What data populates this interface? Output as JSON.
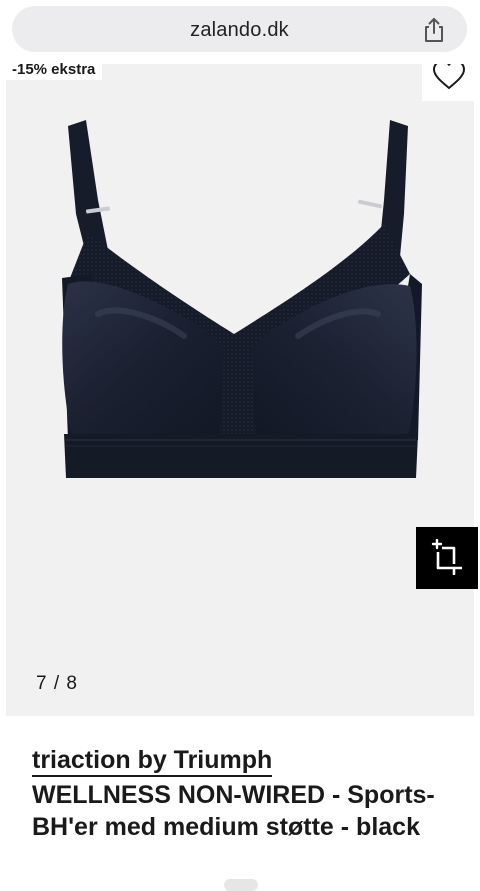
{
  "browser": {
    "url": "zalando.dk",
    "share_icon": "share-icon"
  },
  "gallery": {
    "badge": "-15% ekstra",
    "wishlist_icon": "heart-outline-icon",
    "crop_icon": "crop-sparkle-icon",
    "counter": "7 / 8",
    "background": "#f1f1f1"
  },
  "product": {
    "brand": "triaction by Triumph",
    "name": "WELLNESS NON-WIRED - Sports-BH'er med medium støtte - black",
    "color": "#1c2333"
  }
}
